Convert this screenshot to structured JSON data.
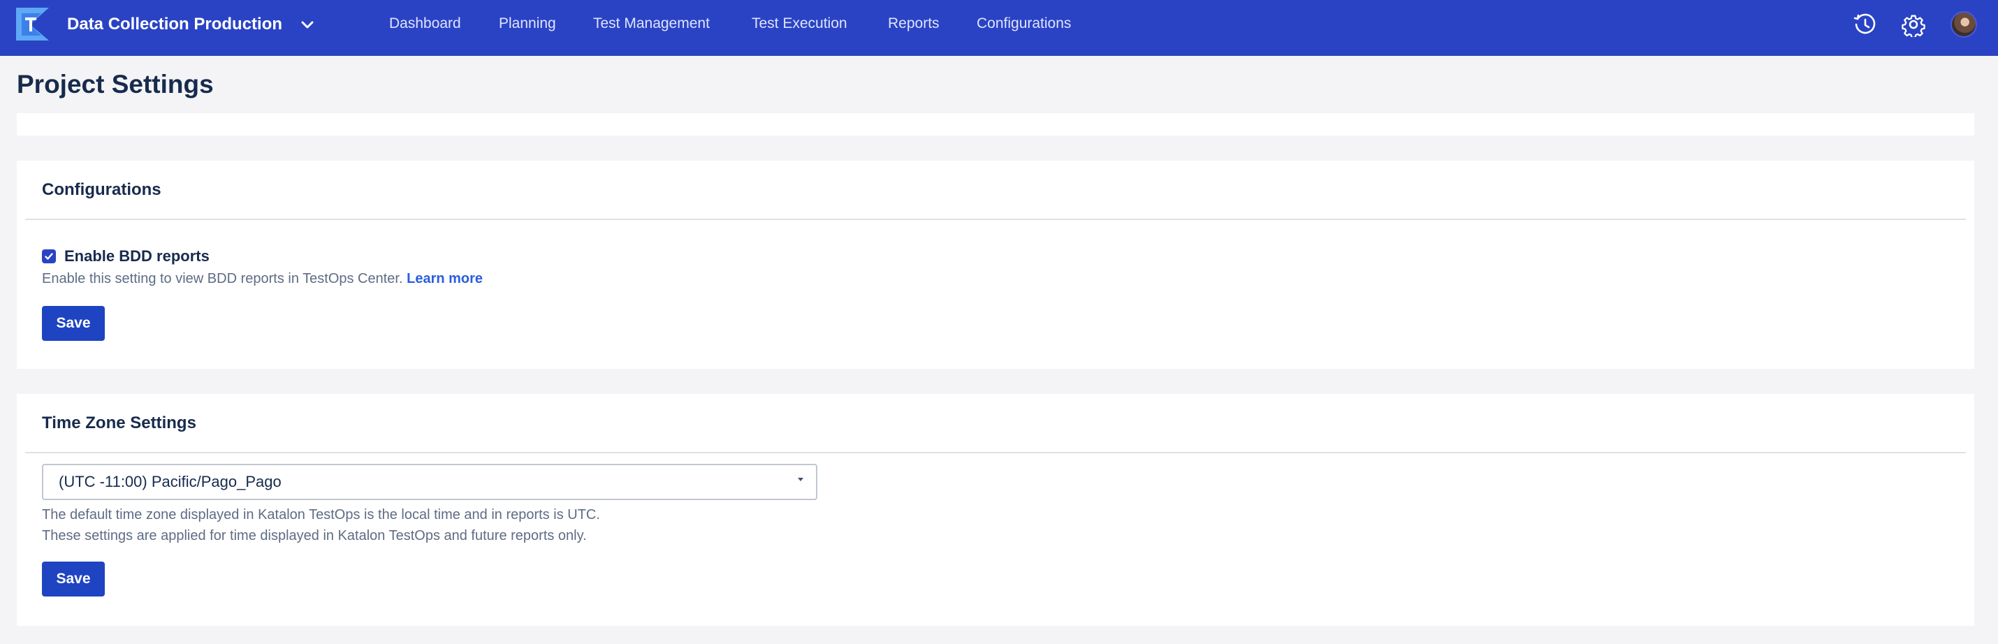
{
  "header": {
    "project_name": "Data Collection Production",
    "nav": [
      "Dashboard",
      "Planning",
      "Test Management",
      "Test Execution",
      "Reports",
      "Configurations"
    ]
  },
  "page": {
    "title": "Project Settings"
  },
  "configurations": {
    "title": "Configurations",
    "bdd_checkbox_label": "Enable BDD reports",
    "bdd_checked": true,
    "help_text": "Enable this setting to view BDD reports in TestOps Center.",
    "learn_more": "Learn more",
    "save_label": "Save"
  },
  "timezone": {
    "title": "Time Zone Settings",
    "selected": "(UTC -11:00) Pacific/Pago_Pago",
    "help_line1": "The default time zone displayed in Katalon TestOps is the local time and in reports is UTC.",
    "help_line2": "These settings are applied for time displayed in Katalon TestOps and future reports only.",
    "save_label": "Save"
  },
  "colors": {
    "topbar": "#2a43c4",
    "primary_button": "#1e44c2",
    "link": "#2a5de0",
    "page_background": "#f4f4f6"
  },
  "icons": [
    "katalon-logo",
    "chevron-down-icon",
    "history-icon",
    "gear-icon",
    "avatar"
  ]
}
